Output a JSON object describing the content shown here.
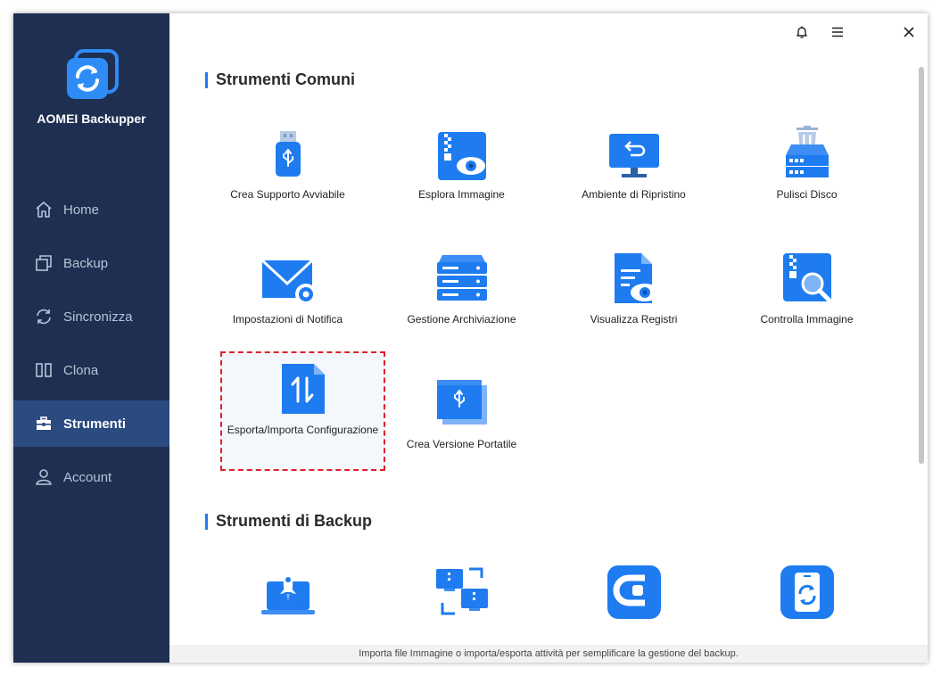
{
  "app": {
    "name": "AOMEI Backupper"
  },
  "sidebar": {
    "items": [
      {
        "label": "Home",
        "icon": "home-icon"
      },
      {
        "label": "Backup",
        "icon": "backup-icon"
      },
      {
        "label": "Sincronizza",
        "icon": "sync-icon"
      },
      {
        "label": "Clona",
        "icon": "clone-icon"
      },
      {
        "label": "Strumenti",
        "icon": "toolbox-icon",
        "active": true
      },
      {
        "label": "Account",
        "icon": "user-icon"
      }
    ]
  },
  "sections": [
    {
      "title": "Strumenti Comuni",
      "tools": [
        {
          "label": "Crea Supporto Avviabile",
          "icon": "usb-drive-icon"
        },
        {
          "label": "Esplora Immagine",
          "icon": "explore-image-icon"
        },
        {
          "label": "Ambiente di Ripristino",
          "icon": "recovery-monitor-icon"
        },
        {
          "label": "Pulisci Disco",
          "icon": "wipe-disk-icon"
        },
        {
          "label": "Impostazioni di Notifica",
          "icon": "notification-mail-icon"
        },
        {
          "label": "Gestione Archiviazione",
          "icon": "storage-server-icon"
        },
        {
          "label": "Visualizza Registri",
          "icon": "view-logs-icon"
        },
        {
          "label": "Controlla Immagine",
          "icon": "check-image-icon"
        },
        {
          "label": "Esporta/Importa Configurazione",
          "icon": "export-import-icon",
          "selected": true
        },
        {
          "label": "Crea Versione Portatile",
          "icon": "portable-version-icon"
        }
      ]
    },
    {
      "title": "Strumenti di Backup",
      "tools": [
        {
          "label": "",
          "icon": "rocket-laptop-icon"
        },
        {
          "label": "",
          "icon": "transfer-computers-icon"
        },
        {
          "label": "",
          "icon": "cbt-icon"
        },
        {
          "label": "",
          "icon": "phone-sync-icon"
        }
      ]
    }
  ],
  "status_text": "Importa file Immagine o importa/esporta attività per semplificare la gestione del backup.",
  "colors": {
    "sidebar_bg": "#1e2f52",
    "sidebar_active": "#2a4a80",
    "accent": "#1f7bf2",
    "selection_border": "#e0202b"
  }
}
